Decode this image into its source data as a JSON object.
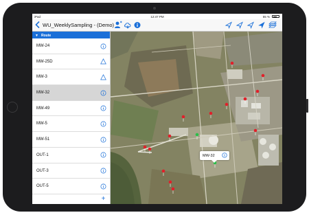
{
  "status_bar": {
    "carrier": "iPad",
    "time": "12:47 PM",
    "battery": "55 %"
  },
  "header": {
    "title": "WU_WeeklySampling - (Demo)"
  },
  "sidebar": {
    "section_label": "Route",
    "items": [
      {
        "label": "MW-24",
        "icon": "info-circle-icon"
      },
      {
        "label": "MW-25D",
        "icon": "warning-triangle-icon"
      },
      {
        "label": "MW-3",
        "icon": "warning-triangle-icon"
      },
      {
        "label": "MW-32",
        "icon": "info-circle-icon",
        "selected": true
      },
      {
        "label": "MW-49",
        "icon": "info-circle-icon"
      },
      {
        "label": "MW-5",
        "icon": "info-circle-icon"
      },
      {
        "label": "MW-51",
        "icon": "info-circle-icon"
      },
      {
        "label": "OUT-1",
        "icon": "info-circle-icon"
      },
      {
        "label": "OUT-3",
        "icon": "info-circle-icon"
      },
      {
        "label": "OUT-5",
        "icon": "info-circle-icon"
      }
    ]
  },
  "map": {
    "callout_label": "MW-32"
  },
  "colors": {
    "accent": "#1a6fd8",
    "pin": "#e0202a",
    "pin_selected": "#2bbf4a"
  }
}
